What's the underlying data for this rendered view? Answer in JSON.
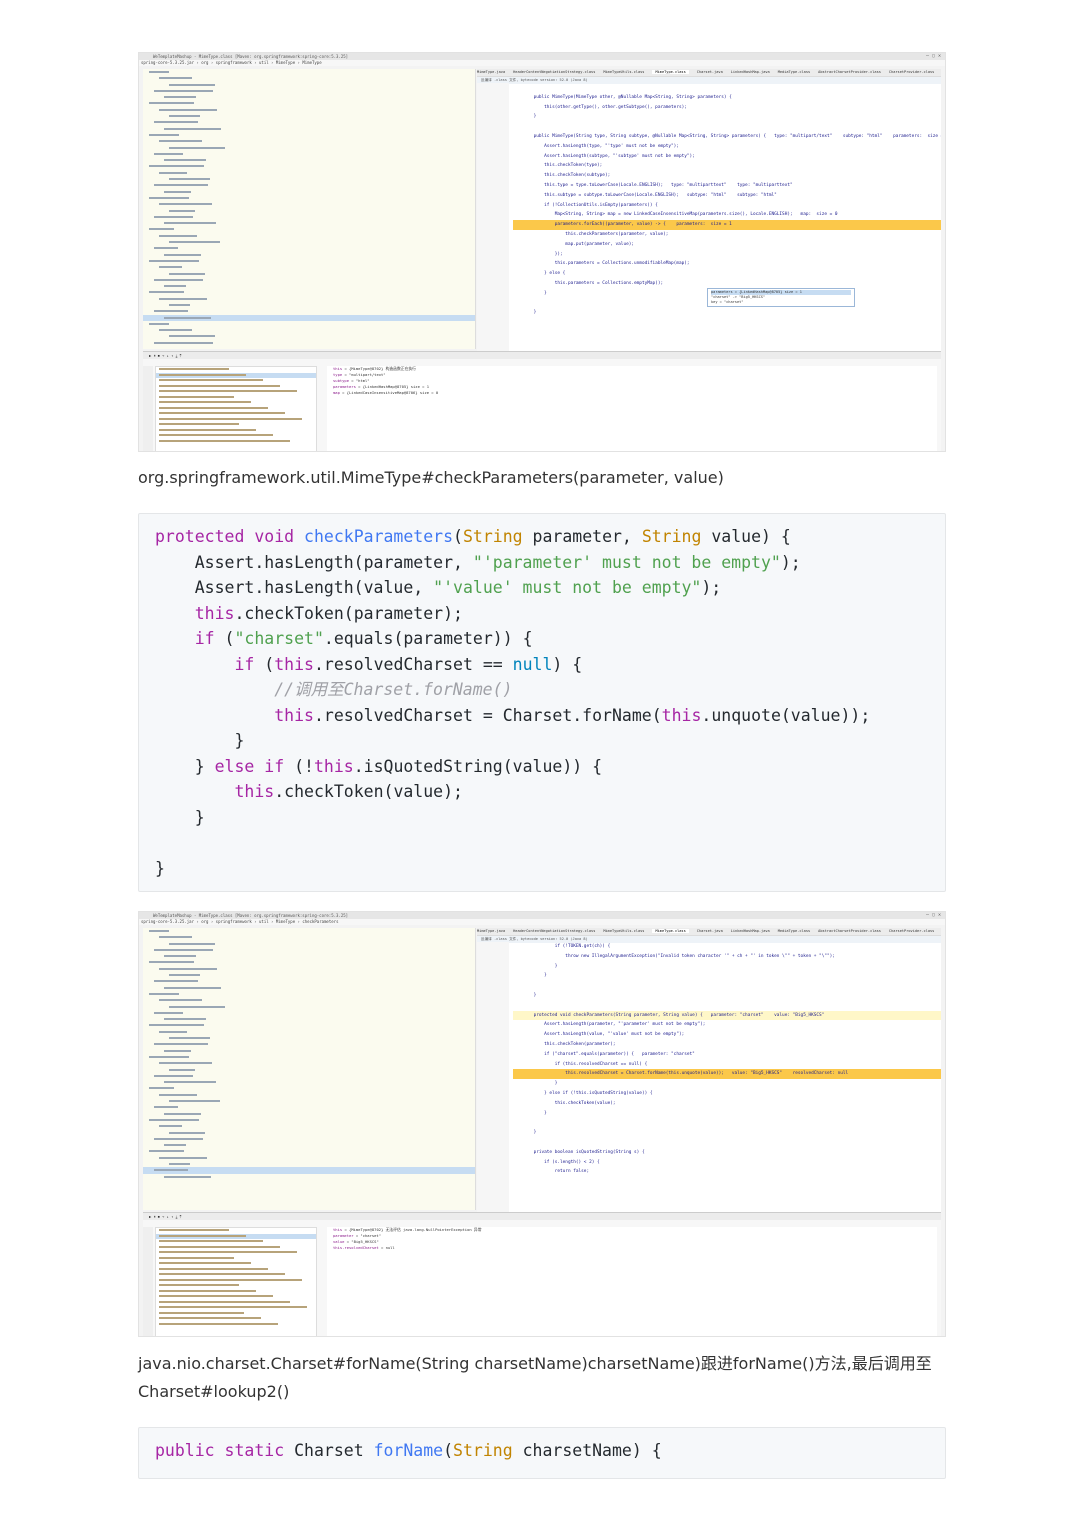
{
  "ide1": {
    "title": "WeTemplateMashup - MimeType.class [Maven: org.springframework:spring-core:5.3.25]",
    "breadcrumb": "spring-core-5.3.25.jar › org › springframework › util › MimeType › MimeType",
    "tabs": [
      "MimeType.java",
      "HeaderContentNegotiationStrategy.class",
      "MimeTypeUtils.class",
      "MimeType.class",
      "Charset.java",
      "LinkedHashMap.java",
      "MediaType.class",
      "AbstractCharsetProvider.class",
      "CharsetProvider.class"
    ],
    "decompiled_notice": "反编译 .class 文件, bytecode version: 52.0 (Java 8)",
    "code_lines": [
      {
        "n": "54",
        "t": ""
      },
      {
        "n": "55",
        "t": "    public MimeType(MimeType other, @Nullable Map<String, String> parameters) {"
      },
      {
        "n": "56",
        "t": "        this(other.getType(), other.getSubtype(), parameters);"
      },
      {
        "n": "57",
        "t": "    }"
      },
      {
        "n": "58",
        "t": ""
      },
      {
        "n": "59",
        "t": "    public MimeType(String type, String subtype, @Nullable Map<String, String> parameters) {   type: \"multipart/text\"    subtype: \"html\"    parameters:  size = 1"
      },
      {
        "n": "60",
        "t": "        Assert.hasLength(type, \"'type' must not be empty\");"
      },
      {
        "n": "61",
        "t": "        Assert.hasLength(subtype, \"'subtype' must not be empty\");"
      },
      {
        "n": "62",
        "t": "        this.checkToken(type);"
      },
      {
        "n": "63",
        "t": "        this.checkToken(subtype);"
      },
      {
        "n": "64",
        "t": "        this.type = type.toLowerCase(Locale.ENGLISH);   type: \"multiparttext\"    type: \"multiparttext\""
      },
      {
        "n": "65",
        "t": "        this.subtype = subtype.toLowerCase(Locale.ENGLISH);   subtype: \"html\"    subtype: \"html\""
      },
      {
        "n": "66",
        "t": "        if (!CollectionUtils.isEmpty(parameters)) {"
      },
      {
        "n": "67",
        "t": "            Map<String, String> map = new LinkedCaseInsensitiveMap(parameters.size(), Locale.ENGLISH);   map:  size = 0"
      },
      {
        "n": "68",
        "t": "            parameters.forEach((parameter, value) -> {    parameters:  size = 1"
      },
      {
        "n": "69",
        "t": "                this.checkParameters(parameter, value);"
      },
      {
        "n": "70",
        "t": "                map.put(parameter, value);"
      },
      {
        "n": "71",
        "t": "            });"
      },
      {
        "n": "72",
        "t": "            this.parameters = Collections.unmodifiableMap(map);"
      },
      {
        "n": "73",
        "t": "        } else {"
      },
      {
        "n": "74",
        "t": "            this.parameters = Collections.emptyMap();"
      },
      {
        "n": "75",
        "t": "        }"
      },
      {
        "n": "76",
        "t": ""
      },
      {
        "n": "77",
        "t": "    }"
      }
    ],
    "popup_rows": [
      "parameters = {LinkedHashMap@8705}  size = 1",
      "\"charset\" -> \"Big5_HKSCS\"",
      "key = \"charset\""
    ],
    "vars": [
      {
        "n": "this",
        "v": " = {MimeType@8702}  构造函数正在执行"
      },
      {
        "n": "type",
        "v": " = \"multipart/text\""
      },
      {
        "n": "subtype",
        "v": " = \"html\""
      },
      {
        "n": "parameters",
        "v": " = {LinkedHashMap@8705}  size = 1"
      },
      {
        "n": "map",
        "v": " = {LinkedCaseInsensitiveMap@8706}  size = 0"
      }
    ]
  },
  "caption1": "org.springframework.util.MimeType#checkParameters(parameter, value)",
  "code1": {
    "l1a": "protected",
    "l1b": " ",
    "l1c": "void",
    "l1d": " ",
    "l1e": "checkParameters",
    "l1f": "(",
    "l1g": "String",
    "l1h": " parameter, ",
    "l1i": "String",
    "l1j": " value) {",
    "l2a": "    Assert.hasLength(parameter, ",
    "l2b": "\"'parameter' must not be empty\"",
    "l2c": ");",
    "l3a": "    Assert.hasLength(value, ",
    "l3b": "\"'value' must not be empty\"",
    "l3c": ");",
    "l4a": "    ",
    "l4b": "this",
    "l4c": ".checkToken(parameter);",
    "l5a": "    ",
    "l5b": "if",
    "l5c": " (",
    "l5d": "\"charset\"",
    "l5e": ".equals(parameter)) {",
    "l6a": "        ",
    "l6b": "if",
    "l6c": " (",
    "l6d": "this",
    "l6e": ".resolvedCharset == ",
    "l6f": "null",
    "l6g": ") {",
    "l7a": "            ",
    "l7b": "//调用至Charset.forName()",
    "l8a": "            ",
    "l8b": "this",
    "l8c": ".resolvedCharset = Charset.forName(",
    "l8d": "this",
    "l8e": ".unquote(value));",
    "l9": "        }",
    "l10a": "    } ",
    "l10b": "else",
    "l10c": " ",
    "l10d": "if",
    "l10e": " (!",
    "l10f": "this",
    "l10g": ".isQuotedString(value)) {",
    "l11a": "        ",
    "l11b": "this",
    "l11c": ".checkToken(value);",
    "l12": "    }",
    "l13": "",
    "l14": "}"
  },
  "ide2": {
    "title": "WeTemplateMashup - MimeType.class [Maven: org.springframework:spring-core:5.3.25]",
    "breadcrumb": "spring-core-5.3.25.jar › org › springframework › util › MimeType › checkParameters",
    "tabs": [
      "MimeType.java",
      "HeaderContentNegotiationStrategy.class",
      "MimeTypeUtils.class",
      "MimeType.class",
      "Charset.java",
      "LinkedHashMap.java",
      "MediaType.class",
      "AbstractCharsetProvider.class",
      "CharsetProvider.class"
    ],
    "decompiled_notice": "反编译 .class 文件, bytecode version: 52.0 (Java 8)",
    "code_lines": [
      {
        "n": "90",
        "t": "            if (!TOKEN.get(ch)) {"
      },
      {
        "n": "91",
        "t": "                throw new IllegalArgumentException(\"Invalid token character '\" + ch + \"' in token \\\"\" + token + \"\\\"\");"
      },
      {
        "n": "92",
        "t": "            }"
      },
      {
        "n": "93",
        "t": "        }"
      },
      {
        "n": "94",
        "t": ""
      },
      {
        "n": "95",
        "t": "    }"
      },
      {
        "n": "96",
        "t": ""
      },
      {
        "n": "97",
        "t": "    protected void checkParameters(String parameter, String value) {   parameter: \"charset\"    value: \"Big5_HKSCS\""
      },
      {
        "n": "98",
        "t": "        Assert.hasLength(parameter, \"'parameter' must not be empty\");"
      },
      {
        "n": "99",
        "t": "        Assert.hasLength(value, \"'value' must not be empty\");"
      },
      {
        "n": "100",
        "t": "        this.checkToken(parameter);"
      },
      {
        "n": "101",
        "t": "        if (\"charset\".equals(parameter)) {   parameter: \"charset\""
      },
      {
        "n": "102",
        "t": "            if (this.resolvedCharset == null) {"
      },
      {
        "n": "103",
        "t": "                this.resolvedCharset = Charset.forName(this.unquote(value));   value: \"Big5_HKSCS\"    resolvedCharset: null"
      },
      {
        "n": "104",
        "t": "            }"
      },
      {
        "n": "105",
        "t": "        } else if (!this.isQuotedString(value)) {"
      },
      {
        "n": "106",
        "t": "            this.checkToken(value);"
      },
      {
        "n": "107",
        "t": "        }"
      },
      {
        "n": "108",
        "t": ""
      },
      {
        "n": "109",
        "t": "    }"
      },
      {
        "n": "110",
        "t": ""
      },
      {
        "n": "111",
        "t": "    private boolean isQuotedString(String s) {"
      },
      {
        "n": "112",
        "t": "        if (s.length() < 2) {"
      },
      {
        "n": "113",
        "t": "            return false;"
      }
    ],
    "vars": [
      {
        "n": "this",
        "v": " = {MimeType@8702} 无法评估 java.lang.NullPointerException 异常"
      },
      {
        "n": "parameter",
        "v": " = \"charset\""
      },
      {
        "n": "value",
        "v": " = \"Big5_HKSCS\""
      },
      {
        "n": "this.resolvedCharset",
        "v": " = null"
      }
    ]
  },
  "caption2": "java.nio.charset.Charset#forName(String charsetName)charsetName)跟进forName()方法,最后调用至Charset#lookup2()",
  "code2": {
    "a": "public",
    "b": " ",
    "c": "static",
    "d": " Charset ",
    "e": "forName",
    "f": "(",
    "g": "String",
    "h": " charsetName) {"
  }
}
